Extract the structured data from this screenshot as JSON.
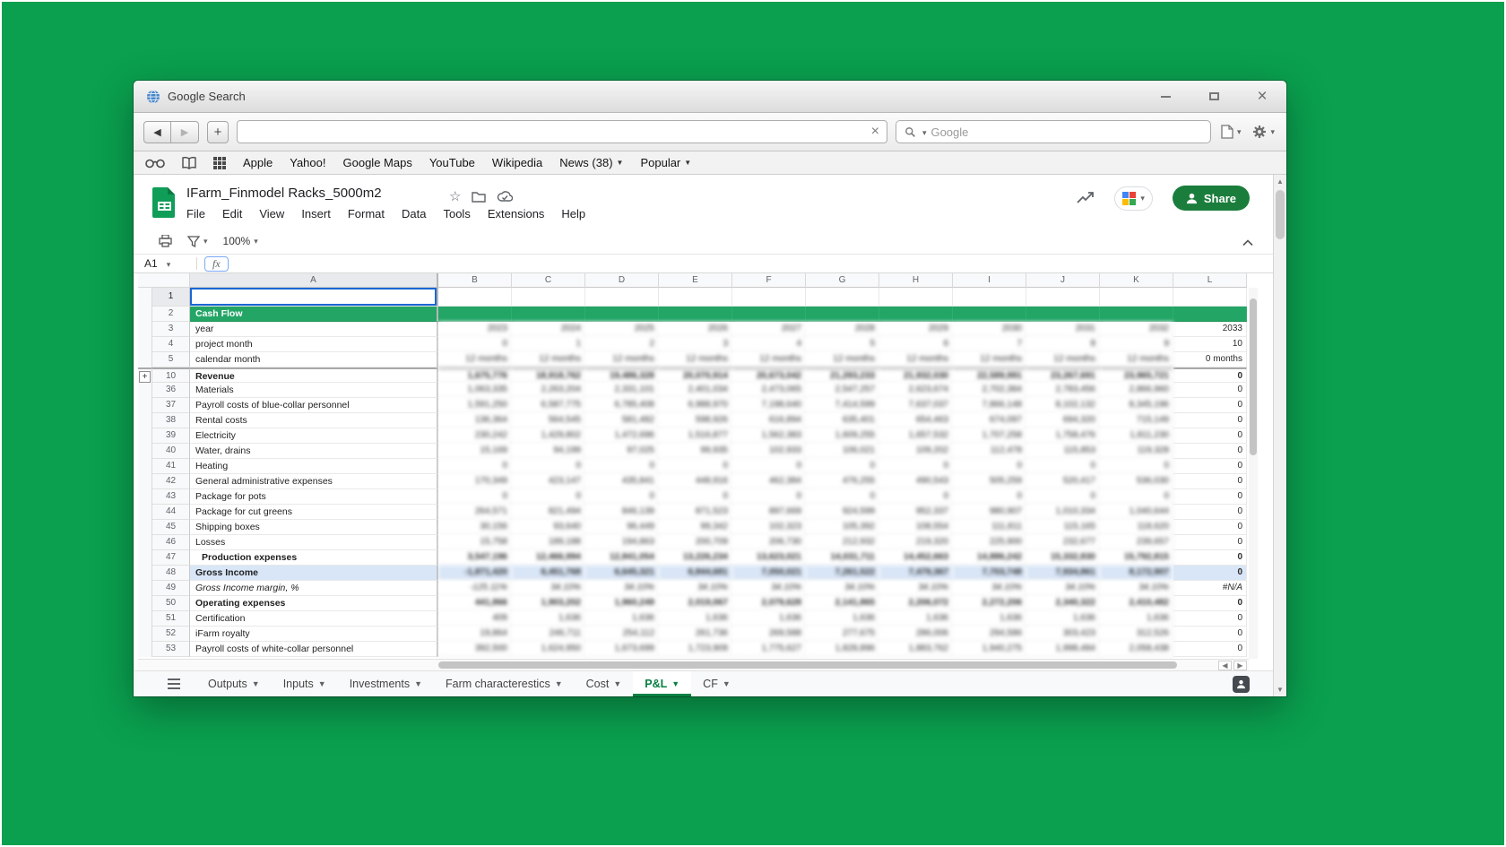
{
  "window": {
    "title": "Google Search"
  },
  "navbar": {
    "address_value": "",
    "search_placeholder": "Google"
  },
  "bookmarks": {
    "items": [
      {
        "label": "Apple",
        "dropdown": false
      },
      {
        "label": "Yahoo!",
        "dropdown": false
      },
      {
        "label": "Google Maps",
        "dropdown": false
      },
      {
        "label": "YouTube",
        "dropdown": false
      },
      {
        "label": "Wikipedia",
        "dropdown": false
      },
      {
        "label": "News (38)",
        "dropdown": true
      },
      {
        "label": "Popular",
        "dropdown": true
      }
    ]
  },
  "sheets": {
    "doc_title": "IFarm_Finmodel Racks_5000m2",
    "menus": [
      "File",
      "Edit",
      "View",
      "Insert",
      "Format",
      "Data",
      "Tools",
      "Extensions",
      "Help"
    ],
    "zoom": "100%",
    "share_label": "Share",
    "name_box": "A1",
    "fx_label": "fx"
  },
  "icons": {
    "globe": "browser site favicon",
    "magnifier": "search",
    "gear": "browser settings",
    "funnel": "create a filter",
    "printer": "print",
    "star": "star this document",
    "folder": "move to folder",
    "cloud": "document saved status",
    "activity": "see document activity",
    "person": "share with people"
  },
  "grid": {
    "columns": [
      "A",
      "B",
      "C",
      "D",
      "E",
      "F",
      "G",
      "H",
      "I",
      "J",
      "K",
      "L"
    ],
    "rows": [
      {
        "num": "1",
        "label": "",
        "style": "selected",
        "values": [
          "",
          "",
          "",
          "",
          "",
          "",
          "",
          "",
          "",
          "",
          ""
        ]
      },
      {
        "num": "2",
        "label": "Cash Flow",
        "style": "green",
        "values": [
          "",
          "",
          "",
          "",
          "",
          "",
          "",
          "",
          "",
          "",
          ""
        ]
      },
      {
        "num": "3",
        "label": "year",
        "style": "",
        "values": [
          "2023",
          "2024",
          "2025",
          "2026",
          "2027",
          "2028",
          "2029",
          "2030",
          "2031",
          "2032",
          "2033"
        ]
      },
      {
        "num": "4",
        "label": "project month",
        "style": "",
        "values": [
          "0",
          "1",
          "2",
          "3",
          "4",
          "5",
          "6",
          "7",
          "8",
          "9",
          "10"
        ]
      },
      {
        "num": "5",
        "label": "calendar month",
        "style": "",
        "values": [
          "12 months",
          "12 months",
          "12 months",
          "12 months",
          "12 months",
          "12 months",
          "12 months",
          "12 months",
          "12 months",
          "12 months",
          "0 months"
        ]
      },
      {
        "num": "10",
        "label": "Revenue",
        "style": "bold frozen",
        "group": true,
        "values": [
          "1,675,776",
          "18,918,762",
          "19,486,328",
          "20,070,914",
          "20,673,042",
          "21,293,233",
          "21,932,030",
          "22,589,991",
          "23,267,691",
          "23,965,721",
          "0"
        ]
      },
      {
        "num": "36",
        "label": "Materials",
        "style": "",
        "values": [
          "1,063,335",
          "2,263,204",
          "2,331,101",
          "2,401,034",
          "2,473,065",
          "2,547,257",
          "2,623,674",
          "2,702,384",
          "2,783,456",
          "2,866,960",
          "0"
        ]
      },
      {
        "num": "37",
        "label": "Payroll costs of blue-collar personnel",
        "style": "",
        "values": [
          "1,591,250",
          "6,587,775",
          "6,785,408",
          "6,988,970",
          "7,198,640",
          "7,414,599",
          "7,637,037",
          "7,866,148",
          "8,102,132",
          "8,345,196",
          "0"
        ]
      },
      {
        "num": "38",
        "label": "Rental costs",
        "style": "",
        "values": [
          "136,364",
          "564,545",
          "581,482",
          "598,926",
          "616,894",
          "635,401",
          "654,463",
          "674,097",
          "694,320",
          "715,149",
          "0"
        ]
      },
      {
        "num": "39",
        "label": "Electricity",
        "style": "",
        "values": [
          "230,242",
          "1,429,802",
          "1,472,696",
          "1,516,877",
          "1,562,383",
          "1,609,255",
          "1,657,532",
          "1,707,258",
          "1,758,476",
          "1,811,230",
          "0"
        ]
      },
      {
        "num": "40",
        "label": "Water, drains",
        "style": "",
        "values": [
          "15,169",
          "94,199",
          "97,025",
          "99,935",
          "102,933",
          "106,021",
          "109,202",
          "112,478",
          "115,853",
          "119,328",
          "0"
        ]
      },
      {
        "num": "41",
        "label": "Heating",
        "style": "",
        "values": [
          "0",
          "0",
          "0",
          "0",
          "0",
          "0",
          "0",
          "0",
          "0",
          "0",
          "0"
        ]
      },
      {
        "num": "42",
        "label": "General administrative expenses",
        "style": "",
        "values": [
          "170,349",
          "423,147",
          "435,841",
          "448,916",
          "462,384",
          "476,255",
          "490,543",
          "505,259",
          "520,417",
          "536,030",
          "0"
        ]
      },
      {
        "num": "43",
        "label": "Package for pots",
        "style": "",
        "values": [
          "0",
          "0",
          "0",
          "0",
          "0",
          "0",
          "0",
          "0",
          "0",
          "0",
          "0"
        ]
      },
      {
        "num": "44",
        "label": "Package for cut greens",
        "style": "",
        "values": [
          "264,571",
          "821,494",
          "846,139",
          "871,523",
          "897,669",
          "924,599",
          "952,337",
          "980,907",
          "1,010,334",
          "1,040,644",
          "0"
        ]
      },
      {
        "num": "45",
        "label": "Shipping boxes",
        "style": "",
        "values": [
          "30,156",
          "93,640",
          "96,449",
          "99,342",
          "102,323",
          "105,392",
          "108,554",
          "111,811",
          "115,165",
          "118,620",
          "0"
        ]
      },
      {
        "num": "46",
        "label": "Losses",
        "style": "",
        "values": [
          "15,758",
          "189,188",
          "194,863",
          "200,709",
          "206,730",
          "212,932",
          "219,320",
          "225,900",
          "232,677",
          "239,657",
          "0"
        ]
      },
      {
        "num": "47",
        "label": "Production expenses",
        "style": "bold indent",
        "values": [
          "3,547,196",
          "12,466,994",
          "12,841,054",
          "13,226,234",
          "13,623,021",
          "14,031,711",
          "14,452,663",
          "14,886,242",
          "15,332,830",
          "15,792,815",
          "0"
        ]
      },
      {
        "num": "48",
        "label": "Gross Income",
        "style": "bold highlight",
        "values": [
          "-1,871,420",
          "6,451,768",
          "6,645,321",
          "6,844,681",
          "7,050,021",
          "7,261,522",
          "7,479,367",
          "7,703,748",
          "7,934,861",
          "8,172,907",
          "0"
        ]
      },
      {
        "num": "49",
        "label": "Gross Income margin, %",
        "style": "italic",
        "values": [
          "-125.11%",
          "34.10%",
          "34.10%",
          "34.10%",
          "34.10%",
          "34.10%",
          "34.10%",
          "34.10%",
          "34.10%",
          "34.10%",
          "#N/A"
        ]
      },
      {
        "num": "50",
        "label": "Operating expenses",
        "style": "bold",
        "values": [
          "441,866",
          "1,903,202",
          "1,960,249",
          "2,019,067",
          "2,079,628",
          "2,141,865",
          "2,206,072",
          "2,272,206",
          "2,340,322",
          "2,410,482",
          "0"
        ]
      },
      {
        "num": "51",
        "label": "Certification",
        "style": "",
        "values": [
          "409",
          "1,636",
          "1,636",
          "1,636",
          "1,636",
          "1,636",
          "1,636",
          "1,636",
          "1,636",
          "1,636",
          "0"
        ]
      },
      {
        "num": "52",
        "label": "iFarm royalty",
        "style": "",
        "values": [
          "19,864",
          "246,711",
          "254,112",
          "261,736",
          "269,588",
          "277,675",
          "286,006",
          "294,586",
          "303,423",
          "312,526",
          "0"
        ]
      },
      {
        "num": "53",
        "label": "Payroll costs of white-collar personnel",
        "style": "",
        "values": [
          "392,500",
          "1,624,950",
          "1,673,699",
          "1,723,909",
          "1,775,627",
          "1,828,896",
          "1,883,762",
          "1,940,275",
          "1,998,484",
          "2,058,438",
          "0"
        ]
      }
    ]
  },
  "tabbar": {
    "tabs": [
      {
        "label": "Outputs",
        "active": false
      },
      {
        "label": "Inputs",
        "active": false
      },
      {
        "label": "Investments",
        "active": false
      },
      {
        "label": "Farm characterestics",
        "active": false
      },
      {
        "label": "Cost",
        "active": false
      },
      {
        "label": "P&L",
        "active": true
      },
      {
        "label": "CF",
        "active": false
      }
    ]
  }
}
